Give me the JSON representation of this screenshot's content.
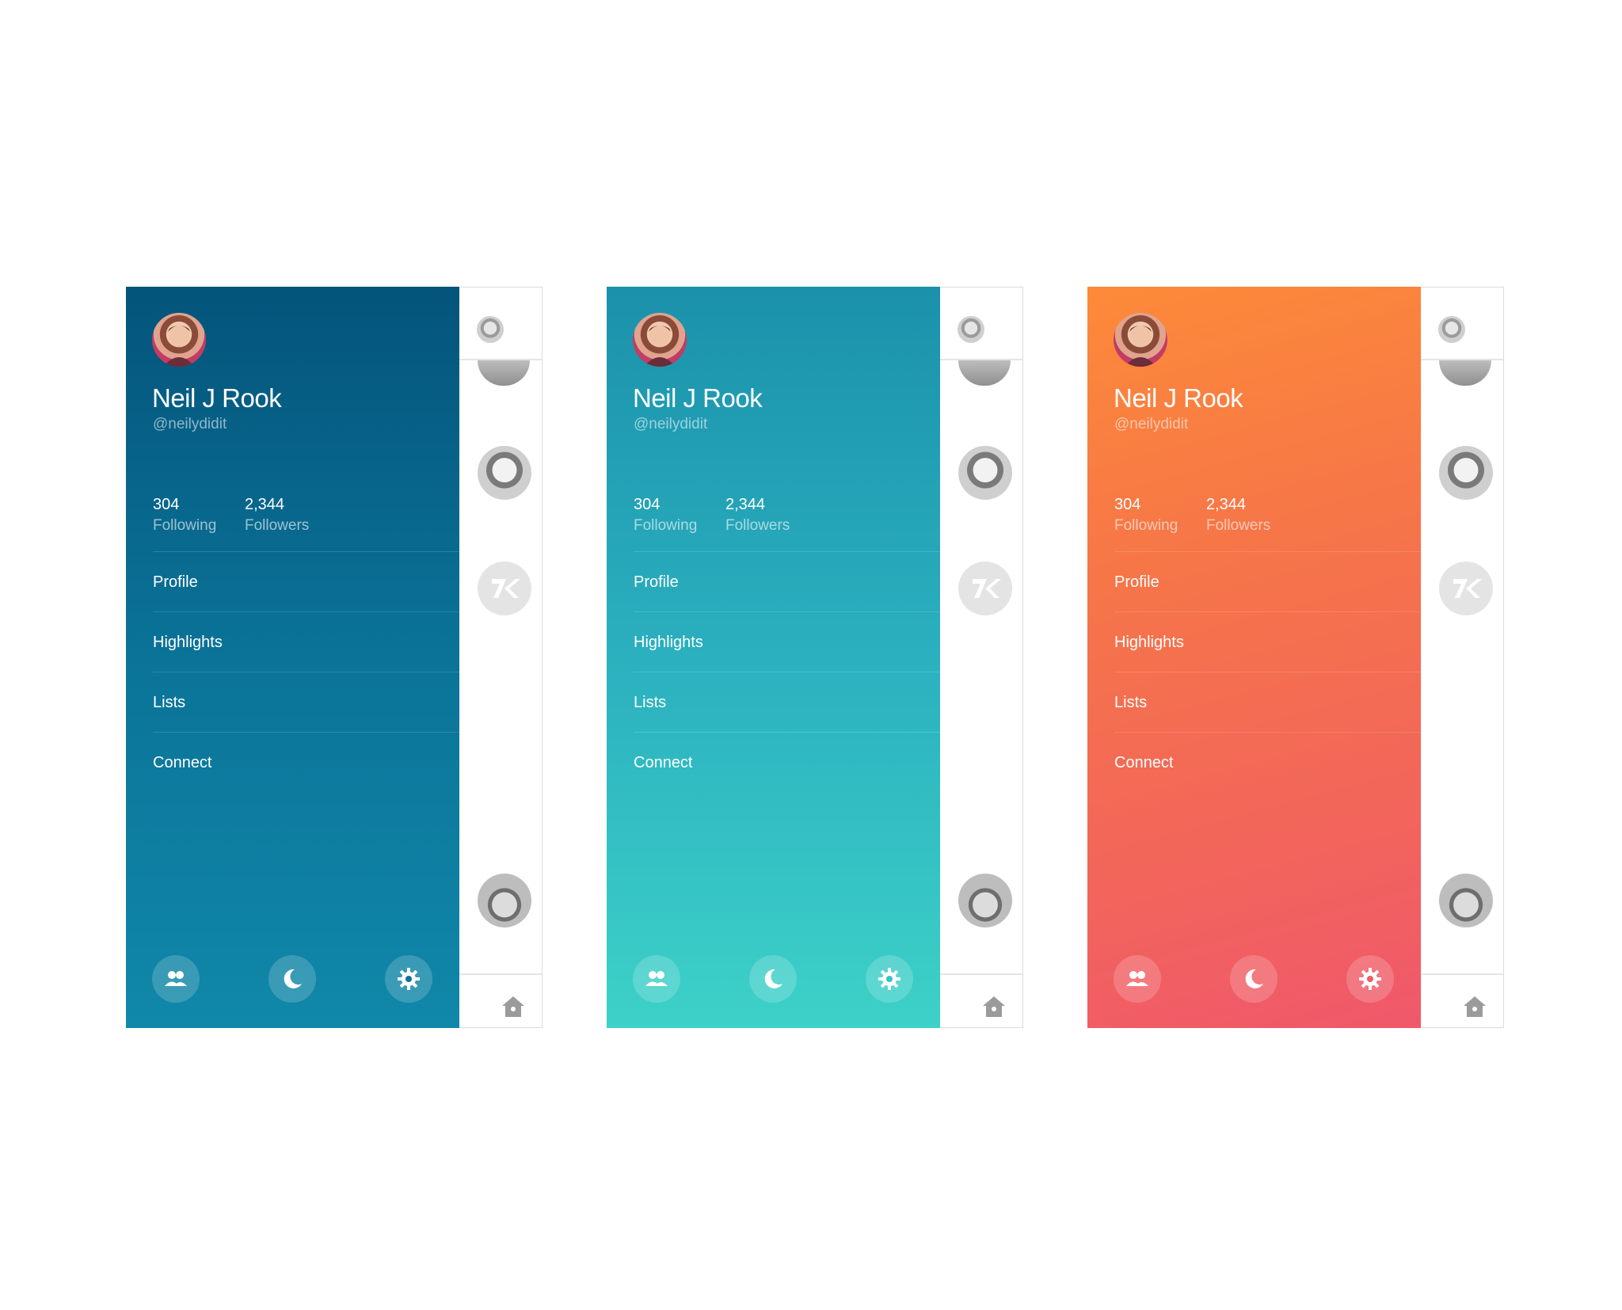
{
  "variants": [
    {
      "theme": "blue",
      "accent": "#04547b",
      "name": "Neil J Rook",
      "handle": "@neilydidit",
      "following_count": "304",
      "following_label": "Following",
      "followers_count": "2,344",
      "followers_label": "Followers",
      "menu": [
        "Profile",
        "Highlights",
        "Lists",
        "Connect"
      ]
    },
    {
      "theme": "teal",
      "accent": "#2bb0bf",
      "name": "Neil J Rook",
      "handle": "@neilydidit",
      "following_count": "304",
      "following_label": "Following",
      "followers_count": "2,344",
      "followers_label": "Followers",
      "menu": [
        "Profile",
        "Highlights",
        "Lists",
        "Connect"
      ]
    },
    {
      "theme": "orange",
      "accent": "#f67648",
      "name": "Neil J Rook",
      "handle": "@neilydidit",
      "following_count": "304",
      "following_label": "Following",
      "followers_count": "2,344",
      "followers_label": "Followers",
      "menu": [
        "Profile",
        "Highlights",
        "Lists",
        "Connect"
      ]
    }
  ],
  "icons": {
    "bottom": [
      "people-icon",
      "moon-icon",
      "gear-icon"
    ],
    "rail": [
      "avatar-icon",
      "k-logo-icon",
      "home-icon"
    ]
  }
}
